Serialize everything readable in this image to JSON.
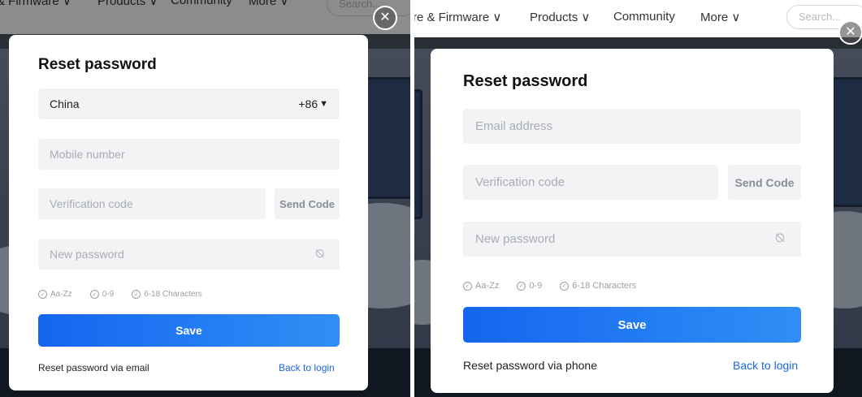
{
  "nav": {
    "left_items": [
      "& Firmware ∨",
      "Products ∨",
      "Community",
      "More ∨"
    ],
    "left_search": "Search...",
    "right_items": [
      "re & Firmware ∨",
      "Products ∨",
      "Community",
      "More ∨"
    ],
    "right_search": "Search..."
  },
  "close_glyph": "✕",
  "phone_reset": {
    "title": "Reset password",
    "country": "China",
    "country_code": "+86",
    "caret": "▼",
    "mobile_placeholder": "Mobile number",
    "code_placeholder": "Verification code",
    "send_code": "Send Code",
    "password_placeholder": "New password",
    "rules": [
      "Aa-Zz",
      "0-9",
      "6-18 Characters"
    ],
    "save": "Save",
    "alt_link": "Reset password via email",
    "back_link": "Back to login"
  },
  "email_reset": {
    "title": "Reset password",
    "email_placeholder": "Email address",
    "code_placeholder": "Verification code",
    "send_code": "Send Code",
    "password_placeholder": "New password",
    "rules": [
      "Aa-Zz",
      "0-9",
      "6-18 Characters"
    ],
    "save": "Save",
    "alt_link": "Reset password via phone",
    "back_link": "Back to login"
  },
  "icons": {
    "check": "✓",
    "eye_off": "⦰"
  },
  "colors": {
    "primary": "#1a66e0",
    "field_bg": "#f2f3f5",
    "placeholder": "#a9adb3"
  }
}
